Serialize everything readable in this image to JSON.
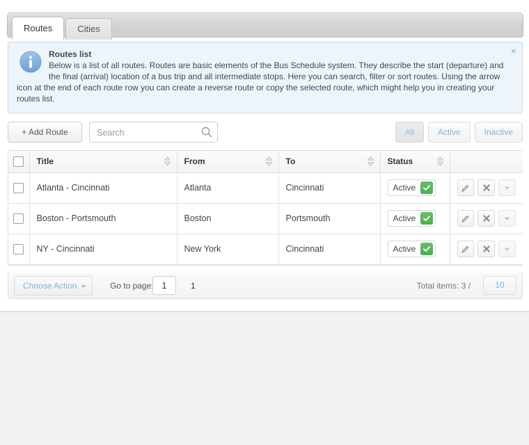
{
  "tabs": [
    {
      "label": "Routes",
      "active": true
    },
    {
      "label": "Cities",
      "active": false
    }
  ],
  "info": {
    "icon": "info-circle-icon",
    "title": "Routes list",
    "line1": "Below is a list of all routes. Routes are basic elements of the Bus Schedule system. They describe the start (departure) and",
    "line2": "the final (arrival) location of a bus trip and all intermediate stops. Here you can search, filter or sort routes. Using the arrow",
    "line3": "icon at the end of each route row you can create a reverse route or copy the selected route, which might help you in creating your",
    "line4": "routes list.",
    "close_label": "×"
  },
  "toolbar": {
    "add_route_label": "+ Add Route",
    "search_placeholder": "Search",
    "search_value": "",
    "search_icon": "search-icon",
    "filters": [
      {
        "label": "All",
        "selected": true
      },
      {
        "label": "Active",
        "selected": false
      },
      {
        "label": "Inactive",
        "selected": false
      }
    ]
  },
  "table": {
    "columns": [
      {
        "label": "Title",
        "sortable": true
      },
      {
        "label": "From",
        "sortable": true
      },
      {
        "label": "To",
        "sortable": true
      },
      {
        "label": "Status",
        "sortable": true
      }
    ],
    "rows": [
      {
        "checked": false,
        "title": "Atlanta - Cincinnati",
        "from": "Atlanta",
        "to": "Cincinnati",
        "status": "Active",
        "status_mark": "✔"
      },
      {
        "checked": false,
        "title": "Boston - Portsmouth",
        "from": "Boston",
        "to": "Portsmouth",
        "status": "Active",
        "status_mark": "✔"
      },
      {
        "checked": false,
        "title": "NY - Cincinnati",
        "from": "New York",
        "to": "Cincinnati",
        "status": "Active",
        "status_mark": "✔"
      }
    ],
    "row_actions": [
      {
        "icon": "pencil-edit-icon"
      },
      {
        "icon": "close-delete-icon"
      },
      {
        "icon": "chevron-down-icon"
      }
    ]
  },
  "footer": {
    "choose_action_label": "Choose Action",
    "goto_page_label": "Go to page:",
    "goto_page_value": "1",
    "page_number": "1",
    "total_items_label": "Total items: 3 /",
    "per_page_value": "10"
  },
  "colors": {
    "accent_blue": "#7fb5d6",
    "status_green": "#4cae4c",
    "panel_bg": "#edf5fa",
    "panel_border": "#c5dcea",
    "page_bg": "#f2f2f2"
  }
}
